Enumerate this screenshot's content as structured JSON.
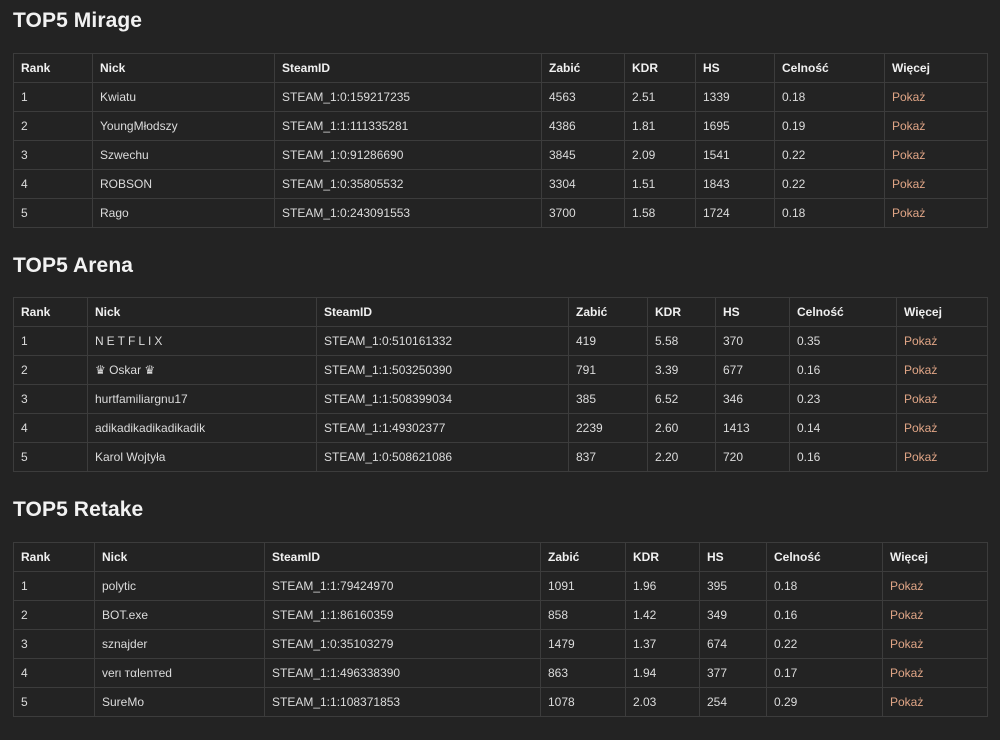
{
  "columns": [
    "Rank",
    "Nick",
    "SteamID",
    "Zabić",
    "KDR",
    "HS",
    "Celność",
    "Więcej"
  ],
  "sections": [
    {
      "title": "TOP5 Mirage",
      "rows": [
        {
          "rank": "1",
          "nick": "Kwiatu",
          "steamid": "STEAM_1:0:159217235",
          "kills": "4563",
          "kdr": "2.51",
          "hs": "1339",
          "accuracy": "0.18",
          "more": "Pokaż"
        },
        {
          "rank": "2",
          "nick": "YoungMłodszy",
          "steamid": "STEAM_1:1:111335281",
          "kills": "4386",
          "kdr": "1.81",
          "hs": "1695",
          "accuracy": "0.19",
          "more": "Pokaż"
        },
        {
          "rank": "3",
          "nick": "Szwechu",
          "steamid": "STEAM_1:0:91286690",
          "kills": "3845",
          "kdr": "2.09",
          "hs": "1541",
          "accuracy": "0.22",
          "more": "Pokaż"
        },
        {
          "rank": "4",
          "nick": "ROBSON",
          "steamid": "STEAM_1:0:35805532",
          "kills": "3304",
          "kdr": "1.51",
          "hs": "1843",
          "accuracy": "0.22",
          "more": "Pokaż"
        },
        {
          "rank": "5",
          "nick": "Rago",
          "steamid": "STEAM_1:0:243091553",
          "kills": "3700",
          "kdr": "1.58",
          "hs": "1724",
          "accuracy": "0.18",
          "more": "Pokaż"
        }
      ]
    },
    {
      "title": "TOP5 Arena",
      "rows": [
        {
          "rank": "1",
          "nick": "NETFLIX",
          "steamid": "STEAM_1:0:510161332",
          "kills": "419",
          "kdr": "5.58",
          "hs": "370",
          "accuracy": "0.35",
          "more": "Pokaż"
        },
        {
          "rank": "2",
          "nick": "♛ Oskar ♛",
          "steamid": "STEAM_1:1:503250390",
          "kills": "791",
          "kdr": "3.39",
          "hs": "677",
          "accuracy": "0.16",
          "more": "Pokaż"
        },
        {
          "rank": "3",
          "nick": "hurtfamiliargnu17",
          "steamid": "STEAM_1:1:508399034",
          "kills": "385",
          "kdr": "6.52",
          "hs": "346",
          "accuracy": "0.23",
          "more": "Pokaż"
        },
        {
          "rank": "4",
          "nick": "adikadikadikadikadik",
          "steamid": "STEAM_1:1:49302377",
          "kills": "2239",
          "kdr": "2.60",
          "hs": "1413",
          "accuracy": "0.14",
          "more": "Pokaż"
        },
        {
          "rank": "5",
          "nick": "Karol Wojtyła",
          "steamid": "STEAM_1:0:508621086",
          "kills": "837",
          "kdr": "2.20",
          "hs": "720",
          "accuracy": "0.16",
          "more": "Pokaż"
        }
      ]
    },
    {
      "title": "TOP5 Retake",
      "rows": [
        {
          "rank": "1",
          "nick": "polytic",
          "steamid": "STEAM_1:1:79424970",
          "kills": "1091",
          "kdr": "1.96",
          "hs": "395",
          "accuracy": "0.18",
          "more": "Pokaż"
        },
        {
          "rank": "2",
          "nick": "BOT.exe",
          "steamid": "STEAM_1:1:86160359",
          "kills": "858",
          "kdr": "1.42",
          "hs": "349",
          "accuracy": "0.16",
          "more": "Pokaż"
        },
        {
          "rank": "3",
          "nick": "sznajder",
          "steamid": "STEAM_1:0:35103279",
          "kills": "1479",
          "kdr": "1.37",
          "hs": "674",
          "accuracy": "0.22",
          "more": "Pokaż"
        },
        {
          "rank": "4",
          "nick": "verι тαlenтed",
          "steamid": "STEAM_1:1:496338390",
          "kills": "863",
          "kdr": "1.94",
          "hs": "377",
          "accuracy": "0.17",
          "more": "Pokaż"
        },
        {
          "rank": "5",
          "nick": "SureMo",
          "steamid": "STEAM_1:1:108371853",
          "kills": "1078",
          "kdr": "2.03",
          "hs": "254",
          "accuracy": "0.29",
          "more": "Pokaż"
        }
      ]
    }
  ]
}
